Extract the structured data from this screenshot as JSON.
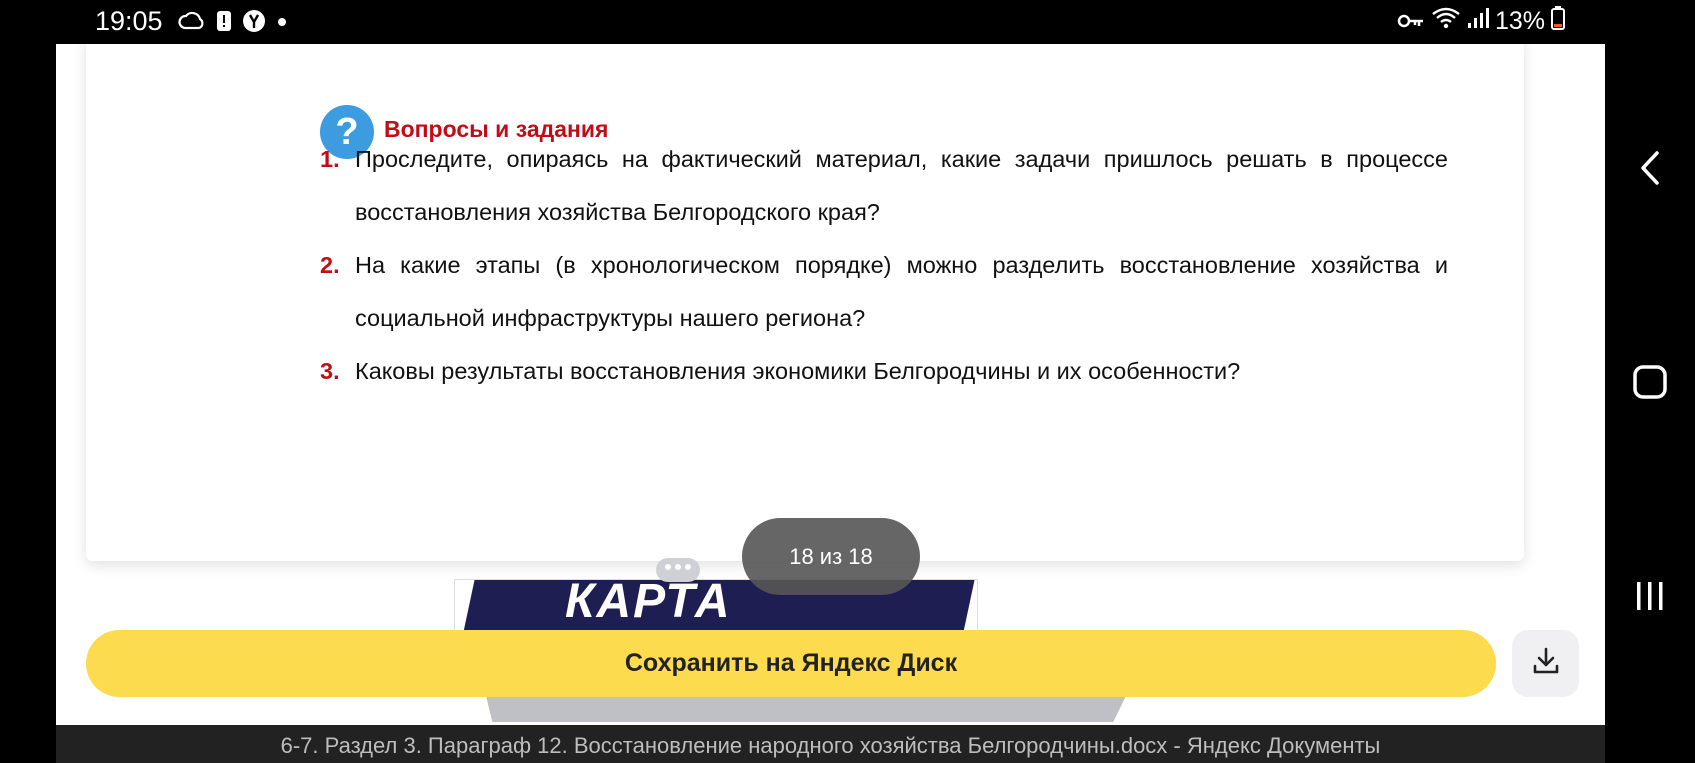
{
  "status_bar": {
    "time": "19:05",
    "battery": "13%",
    "icons": [
      "cloud-icon",
      "alert-icon",
      "yandex-icon",
      "dot-icon",
      "key-icon",
      "wifi-icon",
      "signal-icon",
      "battery-icon"
    ]
  },
  "document": {
    "section_title": "Вопросы и задания",
    "questions": [
      {
        "number": "1.",
        "text": "Проследите, опираясь на фактический материал, какие задачи пришлось решать в процессе восстановления хозяйства Белгородского края?"
      },
      {
        "number": "2.",
        "text": "На какие этапы (в хронологическом порядке) можно разделить восстановление хозяйства и социальной инфраструктуры нашего региона?"
      },
      {
        "number": "3.",
        "text": "Каковы результаты восстановления экономики Белгородчины и их особенности?"
      }
    ],
    "page_counter": "18 из 18",
    "next_page_peek_text": "КАРТА"
  },
  "actions": {
    "save_label": "Сохранить на Яндекс Диск"
  },
  "window_title": "6-7. Раздел 3. Параграф 12. Восстановление народного хозяйства Белгородчины.docx - Яндекс Документы",
  "colors": {
    "accent_red": "#c00d17",
    "question_icon_blue": "#3d9be0",
    "save_button_yellow": "#fddb4e"
  }
}
